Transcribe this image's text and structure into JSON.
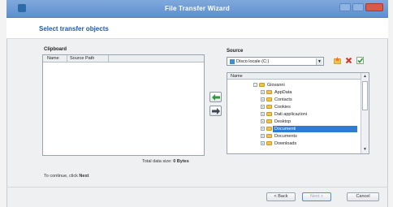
{
  "window": {
    "title": "File Transfer Wizard"
  },
  "header": {
    "title": "Select transfer objects"
  },
  "clipboard": {
    "label": "Clipboard",
    "columns": [
      "Name",
      "Source Path"
    ]
  },
  "source": {
    "label": "Source",
    "selected": "Disco locale (C:)",
    "tree_header": "Name",
    "items": [
      {
        "label": "Giovanni",
        "expander": "-",
        "selected": false
      },
      {
        "label": "AppData",
        "expander": "+",
        "selected": false
      },
      {
        "label": "Contacts",
        "expander": "+",
        "selected": false
      },
      {
        "label": "Cookies",
        "expander": "+",
        "selected": false
      },
      {
        "label": "Dati applicazioni",
        "expander": "+",
        "selected": false
      },
      {
        "label": "Desktop",
        "expander": "+",
        "selected": false
      },
      {
        "label": "Documenti",
        "expander": "+",
        "selected": true
      },
      {
        "label": "Documents",
        "expander": "+",
        "selected": false
      },
      {
        "label": "Downloads",
        "expander": "+",
        "selected": false
      }
    ]
  },
  "status": {
    "total_label": "Total data size:",
    "total_value": "0 Bytes",
    "continue_prefix": "To continue, click",
    "continue_link": "Next"
  },
  "buttons": {
    "back": "< Back",
    "next": "Next >",
    "cancel": "Cancel"
  },
  "icons": {
    "add_arrow": "arrow-left-icon",
    "remove_arrow": "arrow-right-icon",
    "tool1": "folder-star-icon",
    "tool2": "delete-icon",
    "tool3": "checkmark-icon"
  },
  "colors": {
    "title_bar": "#6b97d4",
    "header_text": "#1f58a6",
    "selection": "#2f7bd3"
  }
}
